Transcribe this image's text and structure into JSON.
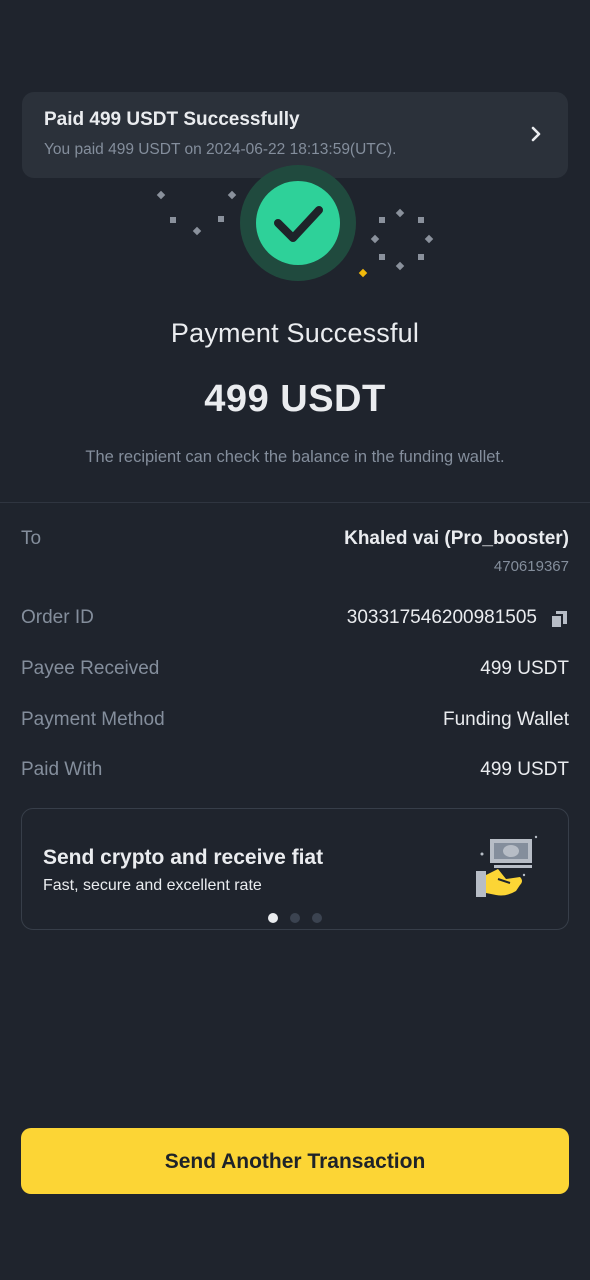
{
  "banner": {
    "title": "Paid 499 USDT Successfully",
    "subtitle": "You paid 499 USDT on 2024-06-22 18:13:59(UTC)."
  },
  "main": {
    "title": "Payment Successful",
    "amount": "499 USDT",
    "note": "The recipient can check the balance in the funding wallet."
  },
  "details": {
    "to_label": "To",
    "to_value": "Khaled vai (Pro_booster)",
    "to_id": "470619367",
    "order_label": "Order ID",
    "order_value": "303317546200981505",
    "payee_label": "Payee Received",
    "payee_value": "499 USDT",
    "method_label": "Payment Method",
    "method_value": "Funding Wallet",
    "paid_label": "Paid With",
    "paid_value": "499 USDT"
  },
  "promo": {
    "title": "Send crypto and receive fiat",
    "subtitle": "Fast, secure and excellent rate",
    "active_page": 1,
    "page_count": 3
  },
  "cta": {
    "label": "Send Another Transaction"
  },
  "colors": {
    "background": "#1f242d",
    "accent": "#fcd535",
    "success": "#2ed199"
  }
}
